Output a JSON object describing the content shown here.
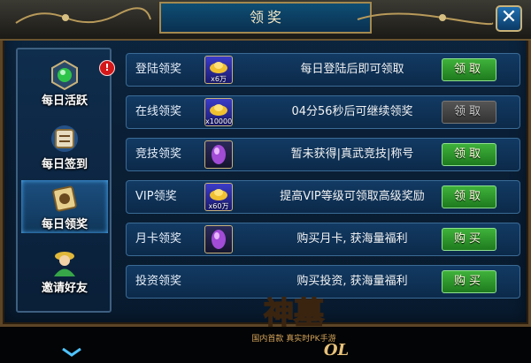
{
  "window": {
    "title": "领奖",
    "close_glyph": "✕"
  },
  "sidebar": {
    "items": [
      {
        "label": "每日活跃",
        "icon": "green-orb-icon",
        "badge": "!"
      },
      {
        "label": "每日签到",
        "icon": "sign-scroll-icon"
      },
      {
        "label": "每日领奖",
        "icon": "reward-token-icon",
        "active": true
      },
      {
        "label": "邀请好友",
        "icon": "friend-figure-icon"
      }
    ],
    "more_icon": "chevron-down-icon"
  },
  "rewards": [
    {
      "title": "登陆领奖",
      "reward_icon": "gold-ingot-icon",
      "reward_qty": "x6万",
      "desc": "每日登陆后即可领取",
      "button": "领取",
      "enabled": true
    },
    {
      "title": "在线领奖",
      "reward_icon": "gold-ingot-icon",
      "reward_qty": "x10000",
      "desc": "04分56秒后可继续领奖",
      "button": "领取",
      "enabled": false
    },
    {
      "title": "竞技领奖",
      "reward_icon": "purple-gem-icon",
      "reward_qty": "",
      "desc": "暂未获得|真武竞技|称号",
      "button": "领取",
      "enabled": true
    },
    {
      "title": "VIP领奖",
      "reward_icon": "gold-ingot-icon",
      "reward_qty": "x60万",
      "desc": "提高VIP等级可领取高级奖励",
      "button": "领取",
      "enabled": true
    },
    {
      "title": "月卡领奖",
      "reward_icon": "purple-gem-icon",
      "reward_qty": "",
      "desc": "购买月卡, 获海量福利",
      "button": "购买",
      "enabled": true
    },
    {
      "title": "投资领奖",
      "reward_icon": "none",
      "reward_qty": "",
      "desc": "购买投资, 获海量福利",
      "button": "购买",
      "enabled": true
    }
  ],
  "logo": {
    "main": "神墓",
    "suffix": "OL",
    "tagline": "国内首款 真实时PK手游"
  },
  "colors": {
    "button_green": "#2e9a2a",
    "button_disabled": "#4a4a4a",
    "accent_gold": "#c9b27a",
    "panel_blue": "#123a63"
  }
}
